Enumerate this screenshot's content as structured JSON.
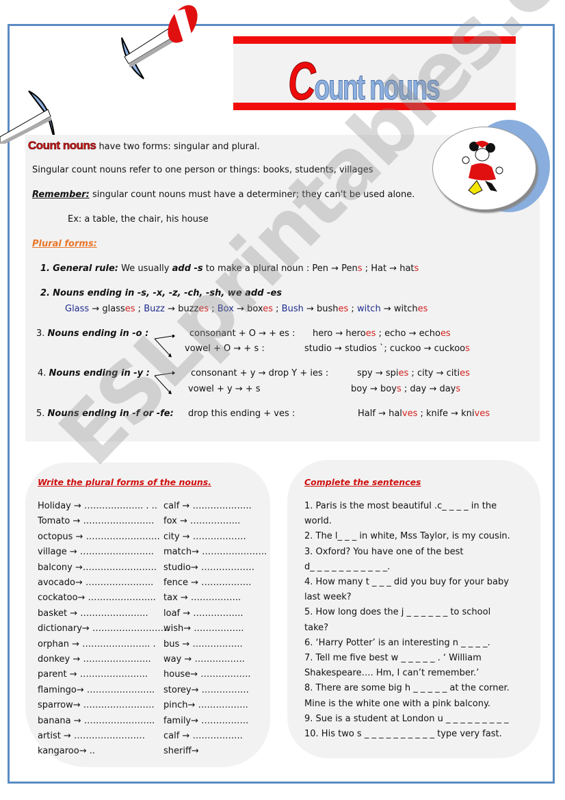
{
  "title": {
    "first_letter": "C",
    "rest": "ount nouns"
  },
  "intro": {
    "lead_term": "Count nouns",
    "lead_rest": " have  two forms: singular and plural.",
    "singular": "Singular count nouns refer to one person or things: books, students, villages",
    "remember_label": "Remember:",
    "remember_text": " singular count nouns must have a determiner; they can't be used alone.",
    "example": "Ex:  a table, the chair, his house",
    "plural_heading": "Plural forms:"
  },
  "rules": {
    "r1": {
      "num": "1.",
      "label": "General rule:",
      "text_a": " We usually ",
      "bold": "add -s",
      "text_b": " to make a plural noun : Pen → Pen",
      "s1": "s",
      "text_c": "  ;   Hat → hat",
      "s2": "s"
    },
    "r2": {
      "num": "2.",
      "label": "Nouns ending in -s,  -x,  -z,  -ch,  -sh, we add -es",
      "examples": [
        {
          "base": "Glass",
          "stem": "glass",
          "suffix": "es"
        },
        {
          "base": "Buzz",
          "stem": "buzz",
          "suffix": "es"
        },
        {
          "base": "Box",
          "stem": "box",
          "suffix": "es"
        },
        {
          "base": "Bush",
          "stem": "bush",
          "suffix": "es"
        },
        {
          "base": "witch",
          "stem": "witch",
          "suffix": "es"
        }
      ]
    },
    "r3": {
      "num": "3.",
      "label": "Nouns ending in -o :",
      "line1": "consonant + O  →   + es :",
      "line2": "vowel + O        →    + s   :",
      "ex1": "hero  →  hero",
      "ex1s": "es",
      "ex2": " ;  echo   →   echo",
      "ex2s": "es",
      "ex3": "studio →   studios `; cuckoo →   cuckoo",
      "ex3s": "s"
    },
    "r4": {
      "num": "4.",
      "label": "Nouns ending in -y :",
      "line1": "consonant + y → drop Y  + ies :",
      "line2": "vowel + y        →     + s",
      "ex1": "spy   →  spi",
      "ex1s": "es",
      "ex2": " ;  city   →   citi",
      "ex2s": "es",
      "ex3": "boy   →  boy",
      "ex3s": "s",
      "ex4": "   ;  day   →    day",
      "ex4s": "s"
    },
    "r5": {
      "num": "5.",
      "label": "Nouns ending in -f or -fe:",
      "line1": "drop this ending +  ves   :",
      "ex1": "Half  →   hal",
      "ex1s": "ves",
      "ex2": "  ; knife  →   kni",
      "ex2s": "ves"
    }
  },
  "exercise1": {
    "heading": "Write the plural forms of the nouns.",
    "left": [
      "Holiday →  ……………….. . ..",
      "Tomato → ……………………",
      "octopus → …………………….",
      "village  → …………………….",
      "balcony →…………………….",
      "avocado→ …………………..",
      "cockatoo→ …………………..",
      "basket  → …………………..",
      "dictionary→ ……………………..",
      "orphan → ………………….. .",
      "donkey → …………………..",
      "parent  → …………………..",
      "flamingo→ …………………..",
      "sparrow→ ……………………",
      "banana → …………………...",
      "artist  → ……………………",
      "kangaroo→                            .."
    ],
    "right": [
      "calf  →  ………………..",
      "fox  →  ……………..",
      "city →   ………………",
      "match→ ………………….",
      "studio→ ………………",
      "fence →  ……………..",
      "tax  →  ……………..",
      "loaf →  ……………..",
      "wish→  ……………..",
      "bus →  ……………..",
      "way →  ……………..",
      "house→  ……………..",
      "storey→  …………….",
      "pinch→  ……………..",
      "family→  …………….",
      "calf →  ……………..",
      "sheriff→"
    ]
  },
  "exercise2": {
    "heading": "Complete the sentences",
    "lines": [
      "1. Paris is the most beautiful .c_ _ _ _ in the",
      "    world.",
      "2. The l_ _ _ in white, Mss Taylor, is my  cousin.",
      "3. Oxford? You have one of the best",
      "   d_ _ _ _ _ _ _ _ _ _ _.",
      "4. How many t _ _ _ did you buy for your baby",
      "    last week?",
      "5. How long does the j _ _ _ _ _ _ to school",
      "    take?",
      "6. ‘Harry Potter’ is an interesting n _ _ _ _.",
      "7. Tell me five best w _ _ _ _ _ . ‘ William",
      "    Shakespeare…. Hm, I can’t remember.’",
      "8. There are some big h _ _ _ _ _ at the corner.",
      "    Mine is the white one with a pink balcony.",
      "9. Sue is a student at London u _ _ _ _ _ _ _ _ _",
      "10. His two s _ _ _ _ _ _ _ _  _ _ type very fast."
    ]
  },
  "watermark": "ESLprintables.com",
  "colors": {
    "frame": "#5b8bc4",
    "title_red": "#f20d0d",
    "accent_red": "#d01010",
    "orange": "#e8762a",
    "panel": "#f2f2f2",
    "suffix_red": "#d42020",
    "word_blue": "#1f2c8f"
  }
}
